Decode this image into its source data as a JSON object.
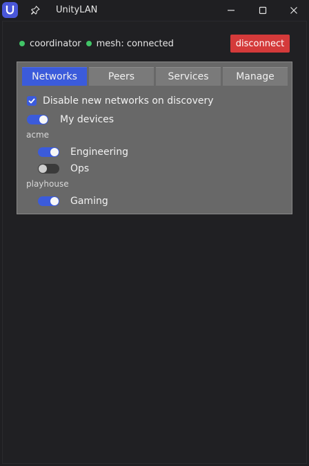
{
  "window": {
    "title": "UnityLAN"
  },
  "status": {
    "coordinator": "coordinator",
    "mesh": "mesh: connected",
    "dot_color": "#41c467"
  },
  "actions": {
    "disconnect": "disconnect"
  },
  "tabs": [
    {
      "label": "Networks",
      "active": true
    },
    {
      "label": "Peers",
      "active": false
    },
    {
      "label": "Services",
      "active": false
    },
    {
      "label": "Manage",
      "active": false
    }
  ],
  "networks": {
    "disable_new_label": "Disable new networks on discovery",
    "disable_new_checked": true,
    "my_devices": {
      "label": "My devices",
      "enabled": true
    },
    "groups": [
      {
        "name": "acme",
        "items": [
          {
            "label": "Engineering",
            "enabled": true
          },
          {
            "label": "Ops",
            "enabled": false
          }
        ]
      },
      {
        "name": "playhouse",
        "items": [
          {
            "label": "Gaming",
            "enabled": true
          }
        ]
      }
    ]
  },
  "colors": {
    "accent": "#3b5bdb",
    "danger": "#d43a3a",
    "panel": "#686868"
  }
}
